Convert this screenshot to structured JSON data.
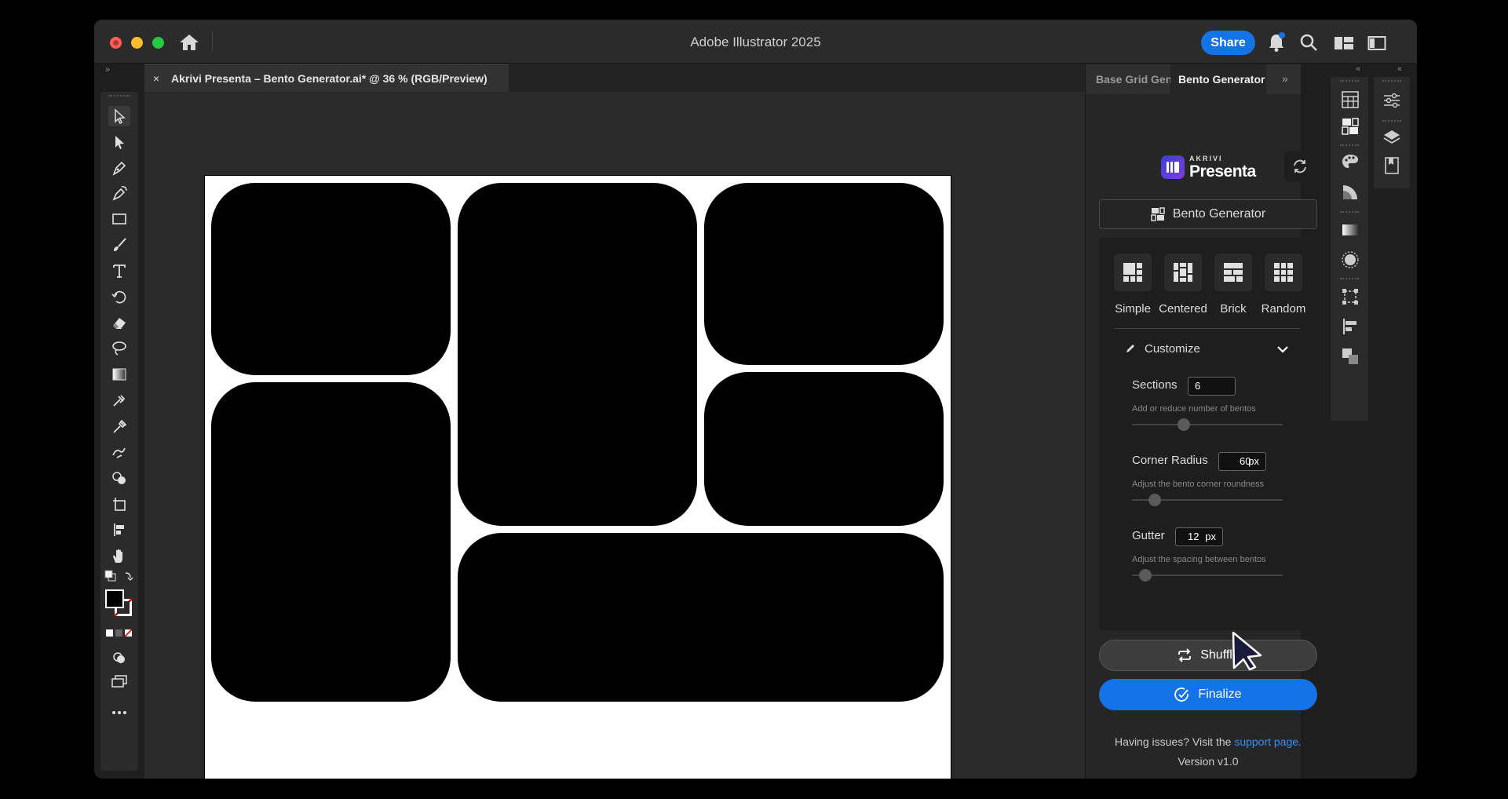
{
  "window": {
    "title": "Adobe Illustrator 2025",
    "share_label": "Share"
  },
  "document": {
    "tab_title": "Akrivi Presenta – Bento Generator.ai* @ 36 % (RGB/Preview)",
    "close_label": "×"
  },
  "panel": {
    "tabs": [
      {
        "label": "Base Grid Generator"
      },
      {
        "label": "Bento Generator"
      }
    ],
    "more_label": "»",
    "logo_small": "AKRIVI",
    "logo_big": "Presenta",
    "title_button": "Bento Generator",
    "layouts": [
      {
        "label": "Simple"
      },
      {
        "label": "Centered"
      },
      {
        "label": "Brick"
      },
      {
        "label": "Random"
      }
    ],
    "customize_label": "Customize",
    "fields": {
      "sections": {
        "label": "Sections",
        "value": "6",
        "help": "Add or reduce number of bentos",
        "slider": 0.33
      },
      "corner_radius": {
        "label": "Corner Radius",
        "value": "60",
        "unit": "px",
        "help": "Adjust the bento corner roundness",
        "slider": 0.12
      },
      "gutter": {
        "label": "Gutter",
        "value": "12",
        "unit": "px",
        "help": "Adjust the spacing between bentos",
        "slider": 0.05
      }
    },
    "shuffle_label": "Shuffle",
    "finalize_label": "Finalize",
    "issues_text": "Having issues? Visit the",
    "support_link": "support page.",
    "version": "Version v1.0"
  },
  "colors": {
    "accent": "#1473e6",
    "link": "#3b8cf5",
    "bento_fill": "#000000",
    "artboard": "#ffffff"
  }
}
